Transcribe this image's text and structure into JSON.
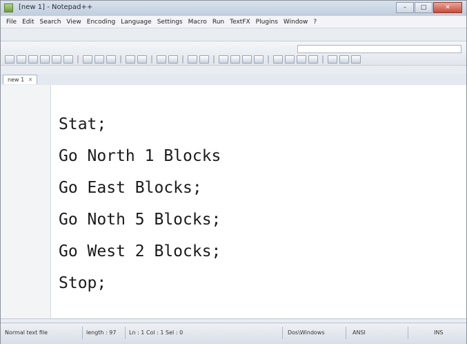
{
  "window": {
    "title": "[new 1] - Notepad++",
    "controls": [
      "–",
      "□",
      "✕"
    ]
  },
  "menu": {
    "items": [
      "File",
      "Edit",
      "Search",
      "View",
      "Encoding",
      "Language",
      "Settings",
      "Macro",
      "Run",
      "TextFX",
      "Plugins",
      "Window",
      "?"
    ]
  },
  "tab": {
    "label": "new 1",
    "close": "✕"
  },
  "editor": {
    "lines": [
      "Stat;",
      "Go North 1 Blocks",
      "Go East Blocks;",
      "Go Noth 5 Blocks;",
      "Go West 2 Blocks;",
      "Stop;"
    ]
  },
  "statusbar": {
    "file_type": "Normal text file",
    "length": "length : 97",
    "position": "Ln : 1   Col : 1   Sel : 0",
    "eol": "Dos\\Windows",
    "encoding": "ANSI",
    "mode": "INS"
  }
}
